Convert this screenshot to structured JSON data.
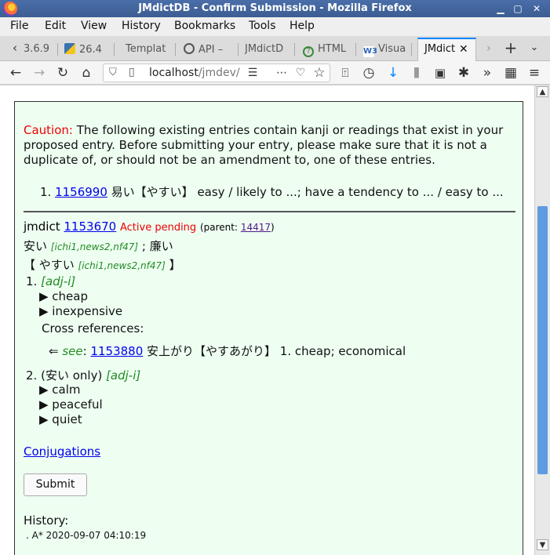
{
  "window": {
    "title": "JMdictDB - Confirm Submission - Mozilla Firefox"
  },
  "menu": [
    "File",
    "Edit",
    "View",
    "History",
    "Bookmarks",
    "Tools",
    "Help"
  ],
  "tabs": [
    {
      "label": "3.6.9"
    },
    {
      "label": "26.4"
    },
    {
      "label": "Templat"
    },
    {
      "label": "API –"
    },
    {
      "label": "JMdictD"
    },
    {
      "label": "HTML"
    },
    {
      "label": "Visua"
    },
    {
      "label": "JMdict"
    }
  ],
  "url": {
    "host": "localhost",
    "path": "/jmdev/"
  },
  "page": {
    "caution_label": "Caution:",
    "caution_text": " The following existing entries contain kanji or readings that exist in your proposed entry. Before submitting your entry, please make sure that it is not a duplicate of, or should not be an amendment to, one of these entries.",
    "dup": {
      "num": "1.",
      "id": "1156990",
      "text": " 易い【やすい】 easy / likely to ...; have a tendency to ... / easy to ..."
    },
    "entry": {
      "corpus": "jmdict",
      "id": "1153670",
      "status": "Active pending",
      "parent_label": "(parent: ",
      "parent_id": "14417",
      "parent_close": ")",
      "kanji1": "安い",
      "kanji1_tags": "[ichi1,news2,nf47]",
      "kanji_sep": " ; ",
      "kanji2": "廉い",
      "reading_open": "【 やすい ",
      "reading_tags": "[ichi1,news2,nf47]",
      "reading_close": " 】",
      "senses": [
        {
          "num": "1.",
          "restr": "",
          "pos": "[adj-i]",
          "glosses": [
            "▶ cheap",
            "▶ inexpensive"
          ]
        },
        {
          "num": "2.",
          "restr": "(安い only) ",
          "pos": "[adj-i]",
          "glosses": [
            "▶ calm",
            "▶ peaceful",
            "▶ quiet"
          ]
        }
      ],
      "xref_label": "Cross references:",
      "xref": {
        "arrow": "⇐ ",
        "see": "see",
        "colon": ": ",
        "id": "1153880",
        "text": " 安上がり【やすあがり】 1. cheap; economical"
      }
    },
    "conjugations": "Conjugations",
    "submit": "Submit",
    "history_label": "History:",
    "history_item": ". A* 2020-09-07 04:10:19"
  }
}
